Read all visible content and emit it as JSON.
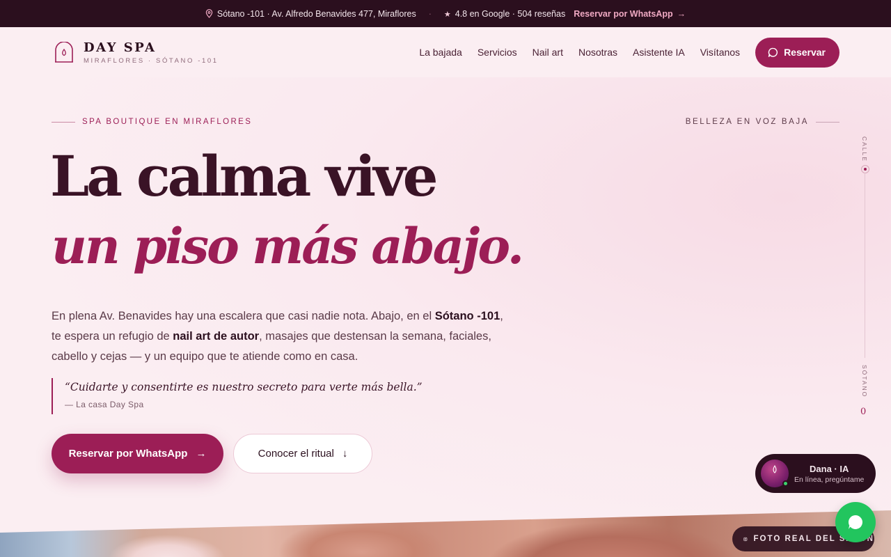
{
  "topbar": {
    "address": "Sótano -101 · Av. Alfredo Benavides 477, Miraflores",
    "rating": "4.8 en Google · 504 reseñas",
    "whatsapp_link": "Reservar por WhatsApp",
    "icons": [
      "map-pin-icon",
      "star-icon",
      "arrow-right-icon"
    ]
  },
  "nav": {
    "brand": "DAY SPA",
    "brand_sub": "MIRAFLORES · SÓTANO -101",
    "items": [
      "La bajada",
      "Servicios",
      "Nail art",
      "Nosotras",
      "Asistente IA",
      "Visítanos"
    ],
    "cta": "Reservar"
  },
  "hero": {
    "eyebrow_left": "SPA BOUTIQUE EN MIRAFLORES",
    "eyebrow_right": "BELLEZA EN VOZ BAJA",
    "title_line1": "La calma vive",
    "title_line2": "un piso más abajo.",
    "lead_1": "En plena Av. Benavides hay una escalera que casi nadie nota. Abajo, en el ",
    "lead_b1": "Sótano -101",
    "lead_2": ", te espera un refugio de ",
    "lead_b2": "nail art de autor",
    "lead_3": ", masajes que destensan la semana, faciales, cabello y cejas — y un equipo que te atiende como en casa.",
    "quote": "“Cuidarte y consentirte es nuestro secreto para verte más bella.”",
    "quote_author": "— La casa Day Spa",
    "cta_primary": "Reservar por WhatsApp",
    "cta_secondary": "Conocer el ritual"
  },
  "scale": {
    "top_label": "CALLE",
    "bottom_label": "SÓTANO",
    "value": "0"
  },
  "photo": {
    "tag": "FOTO REAL DEL SALÓN"
  },
  "assistant": {
    "name": "Dana · IA",
    "status": "En línea, pregúntame",
    "status_color": "#3cd46d"
  },
  "colors": {
    "accent": "#9c1e56",
    "dark": "#2b0f1e",
    "background": "#fbeef2",
    "whatsapp": "#22c55e"
  }
}
